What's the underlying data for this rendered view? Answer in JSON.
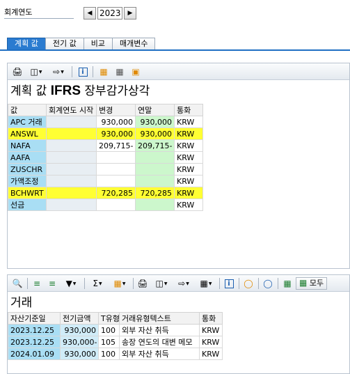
{
  "fiscal_year": {
    "label": "회계연도",
    "value": "2023"
  },
  "tabs": [
    {
      "label": "계획 값",
      "active": true
    },
    {
      "label": "전기 값",
      "active": false
    },
    {
      "label": "비교",
      "active": false
    },
    {
      "label": "매개변수",
      "active": false
    }
  ],
  "plan_panel": {
    "title_prefix": "계획 값",
    "title_strong": "IFRS",
    "title_suffix": "장부감가상각",
    "columns": [
      "값",
      "회계연도 시작",
      "변경",
      "연말",
      "통화"
    ],
    "rows": [
      {
        "value": "APC 거래",
        "start": "",
        "change": "930,000",
        "year_end": "930,000",
        "currency": "KRW",
        "style": "normal"
      },
      {
        "value": "ANSWL",
        "start": "",
        "change": "930,000",
        "year_end": "930,000",
        "currency": "KRW",
        "style": "yellow"
      },
      {
        "value": "NAFA",
        "start": "",
        "change": "209,715-",
        "year_end": "209,715-",
        "currency": "KRW",
        "style": "normal"
      },
      {
        "value": "AAFA",
        "start": "",
        "change": "",
        "year_end": "",
        "currency": "KRW",
        "style": "normal"
      },
      {
        "value": "ZUSCHR",
        "start": "",
        "change": "",
        "year_end": "",
        "currency": "KRW",
        "style": "normal"
      },
      {
        "value": "가액조정",
        "start": "",
        "change": "",
        "year_end": "",
        "currency": "KRW",
        "style": "normal"
      },
      {
        "value": "BCHWRT",
        "start": "",
        "change": "720,285",
        "year_end": "720,285",
        "currency": "KRW",
        "style": "yellow"
      },
      {
        "value": "선금",
        "start": "",
        "change": "",
        "year_end": "",
        "currency": "KRW",
        "style": "normal"
      }
    ]
  },
  "transactions_panel": {
    "title": "거래",
    "mode_button": "모두",
    "columns": [
      "자산기준일",
      "전기금액",
      "T유형",
      "거래유형텍스트",
      "통화"
    ],
    "rows": [
      {
        "date": "2023.12.25",
        "amount": "930,000",
        "type": "100",
        "text": "외부 자산 취득",
        "currency": "KRW"
      },
      {
        "date": "2023.12.25",
        "amount": "930,000-",
        "type": "105",
        "text": "송장 연도의 대변 메모",
        "currency": "KRW"
      },
      {
        "date": "2024.01.09",
        "amount": "930,000",
        "type": "100",
        "text": "외부 자산 취득",
        "currency": "KRW"
      }
    ]
  },
  "icons": {
    "prev": "triangle-left-icon",
    "next": "triangle-right-icon",
    "toolbar1": [
      "print-icon",
      "view-icon",
      "export-icon",
      "info-icon",
      "layout-icon",
      "spreadsheet-icon",
      "graphic-icon"
    ],
    "toolbar2": [
      "details-icon",
      "sort-ascending-icon",
      "sort-descending-icon",
      "filter-icon",
      "sum-icon",
      "subtotal-icon",
      "print-icon",
      "view-icon",
      "export-icon",
      "layout-icon",
      "info-icon",
      "graphic-icon",
      "abc-icon",
      "hierarchy-icon",
      "expand-icon"
    ]
  },
  "colors": {
    "tab_active": "#2a7bd0",
    "key_column": "#a9def4",
    "highlight_yellow": "#ffff33",
    "year_end_green": "#ccf7cc"
  }
}
